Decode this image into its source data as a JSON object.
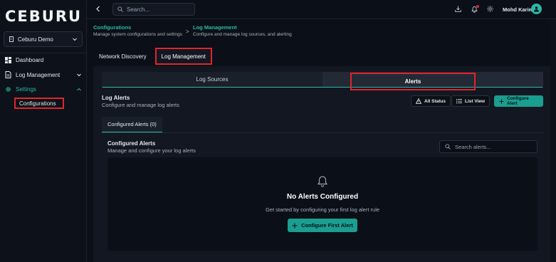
{
  "app": {
    "logo": "CEBURU"
  },
  "sidebar": {
    "workspace": "Ceburu Demo",
    "items": [
      {
        "label": "Dashboard"
      },
      {
        "label": "Log Management"
      },
      {
        "label": "Settings"
      }
    ],
    "sub_items": [
      {
        "label": "Configurations"
      }
    ]
  },
  "topbar": {
    "search_placeholder": "Search...",
    "user_name": "Mohd Karim"
  },
  "breadcrumb": {
    "items": [
      {
        "title": "Configurations",
        "subtitle": "Manage system configurations and settings"
      },
      {
        "title": "Log Management",
        "subtitle": "Configure and manage log sources, and alerting"
      }
    ],
    "separator": ">"
  },
  "tabs": {
    "network_discovery": "Network Discovery",
    "log_management": "Log Management"
  },
  "segments": {
    "log_sources": "Log Sources",
    "alerts": "Alerts"
  },
  "log_alerts": {
    "title": "Log Alerts",
    "subtitle": "Configure and manage log alerts",
    "all_status": "All Status",
    "list_view": "List View",
    "configure_alert": "Configure Alert"
  },
  "configured_tab": "Configured Alerts (0)",
  "configured": {
    "title": "Configured Alerts",
    "subtitle": "Manage and configure your log alerts",
    "search_placeholder": "Search alerts..."
  },
  "empty_state": {
    "title": "No Alerts Configured",
    "subtitle": "Get started by configuring your first log alert rule",
    "button": "Configure First Alert"
  },
  "colors": {
    "accent": "#2bb8a6",
    "button_teal": "#1a9e8f",
    "highlight": "#e0242c",
    "background": "#0b0f17"
  },
  "icons": [
    "workspace-icon",
    "dashboard-icon",
    "file-icon",
    "gear-icon",
    "chevron-down-icon",
    "chevron-up-icon",
    "back-arrow-icon",
    "search-icon",
    "download-icon",
    "bell-icon",
    "sun-icon",
    "user-icon",
    "warning-icon",
    "list-icon",
    "plus-icon"
  ]
}
